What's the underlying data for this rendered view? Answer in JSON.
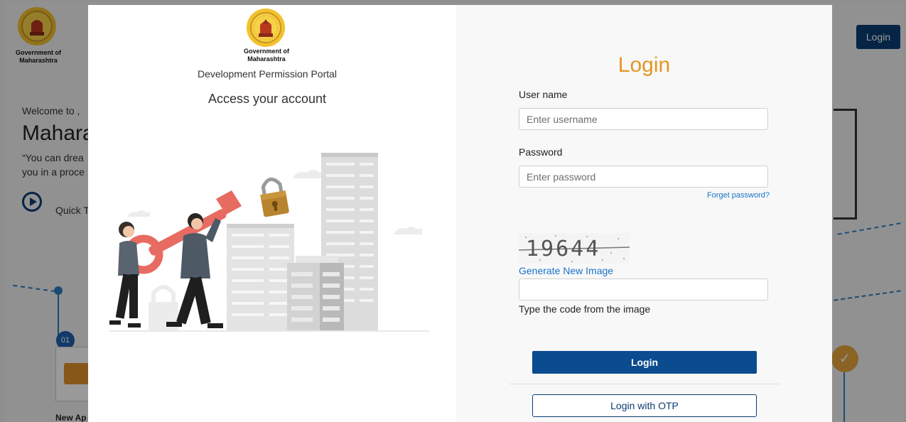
{
  "background": {
    "gov_name": "Government of Maharashtra",
    "welcome": "Welcome to ,",
    "state": "Mahara",
    "quote": "“You can drea you in a proce",
    "quick": "Quick T",
    "step_number": "01",
    "new_app": "New Ap",
    "login_button": "Login",
    "check_icon": "check-icon"
  },
  "modal": {
    "gov_name_line1": "Government of",
    "gov_name_line2": "Maharashtra",
    "portal_name": "Development Permission Portal",
    "access_text": "Access your account",
    "login_title": "Login",
    "username_label": "User name",
    "username_placeholder": "Enter username",
    "password_label": "Password",
    "password_placeholder": "Enter password",
    "forget_password": "Forget password?",
    "captcha_text": "19644",
    "generate_link": "Generate New Image",
    "captcha_value": "",
    "captcha_hint": "Type the code from the image",
    "login_button": "Login",
    "otp_button": "Login with OTP"
  },
  "colors": {
    "accent": "#e39722",
    "primary": "#0b4b8f",
    "link": "#1a73c9"
  }
}
